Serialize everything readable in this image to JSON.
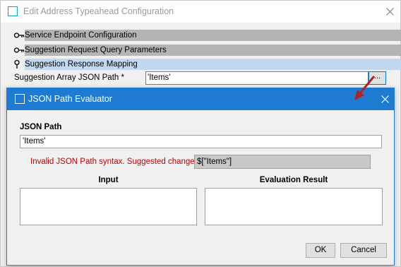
{
  "outer_window": {
    "title": "Edit Address Typeahead Configuration",
    "sections": [
      {
        "label": "Service Endpoint Configuration",
        "icon": "key-icon"
      },
      {
        "label": "Suggestion Request Query Parameters",
        "icon": "key-icon"
      },
      {
        "label": "Suggestion Response Mapping",
        "icon": "pin-icon"
      }
    ],
    "json_path_label": "Suggestion Array JSON Path *",
    "json_path_value": "'Items'",
    "browse_label": "..."
  },
  "dialog": {
    "title": "JSON Path Evaluator",
    "json_path_label": "JSON Path",
    "json_path_value": "'Items'",
    "error_text": "Invalid JSON Path syntax. Suggested change:",
    "suggested_value": "$[\"Items\"]",
    "input_label": "Input",
    "result_label": "Evaluation Result",
    "ok_label": "OK",
    "cancel_label": "Cancel"
  },
  "colors": {
    "accent": "#1e7bd1",
    "error": "#c00000",
    "arrow": "#b22222"
  }
}
